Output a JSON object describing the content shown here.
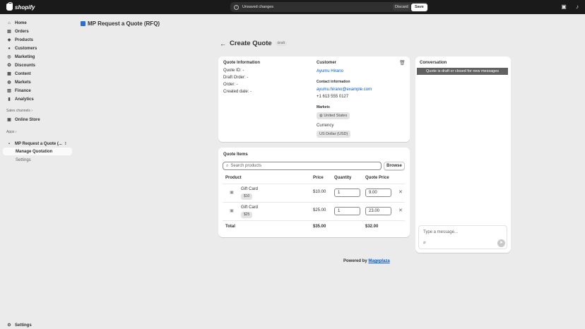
{
  "topbar": {
    "brand": "shopify",
    "unsaved_label": "Unsaved changes",
    "discard_label": "Discard",
    "save_label": "Save"
  },
  "sidebar": {
    "items": [
      {
        "label": "Home",
        "icon": "home-icon"
      },
      {
        "label": "Orders",
        "icon": "orders-icon"
      },
      {
        "label": "Products",
        "icon": "products-icon"
      },
      {
        "label": "Customers",
        "icon": "customers-icon"
      },
      {
        "label": "Marketing",
        "icon": "marketing-icon"
      },
      {
        "label": "Discounts",
        "icon": "discounts-icon"
      },
      {
        "label": "Content",
        "icon": "content-icon"
      },
      {
        "label": "Markets",
        "icon": "markets-icon"
      },
      {
        "label": "Finance",
        "icon": "finance-icon"
      },
      {
        "label": "Analytics",
        "icon": "analytics-icon"
      }
    ],
    "sales_channels_label": "Sales channels",
    "online_store": "Online Store",
    "apps_label": "Apps",
    "app_name": "MP Request a Quote (...",
    "manage_quotation": "Manage Quotation",
    "app_settings": "Settings",
    "settings": "Settings"
  },
  "app_title": "MP Request a Quote (RFQ)",
  "page": {
    "title": "Create Quote",
    "status": "Draft"
  },
  "quote_info": {
    "heading": "Quote Information",
    "quote_id": "Quote ID:  -",
    "draft_order": "Draft Order:  -",
    "order": "Order:  -",
    "created_date": "Created date:  -"
  },
  "customer": {
    "heading": "Customer",
    "name": "Ayumu Hirano",
    "contact_heading": "Contact information",
    "email": "ayumu.hirano@example.com",
    "phone": "+1 613 555 0127",
    "markets_heading": "Markets",
    "market": "United States",
    "currency_heading": "Currency",
    "currency": "US Dollar (USD)"
  },
  "quote_items": {
    "heading": "Quote Items",
    "search_placeholder": "Search products",
    "browse_label": "Browse",
    "columns": {
      "product": "Product",
      "price": "Price",
      "quantity": "Quantity",
      "quote_price": "Quote Price"
    },
    "rows": [
      {
        "name": "Gift Card",
        "variant": "$10",
        "price": "$10.00",
        "quantity": "1",
        "quote_price": "9.00"
      },
      {
        "name": "Gift Card",
        "variant": "$25",
        "price": "$25.00",
        "quantity": "1",
        "quote_price": "23.00"
      }
    ],
    "total_label": "Total",
    "total_price": "$35.00",
    "total_quote": "$32.00"
  },
  "conversation": {
    "heading": "Conversation",
    "banner": "Quote is draft or closed for new messages",
    "placeholder": "Type a message..."
  },
  "footer": {
    "powered_by": "Powered by",
    "brand": "Mageplaza"
  }
}
